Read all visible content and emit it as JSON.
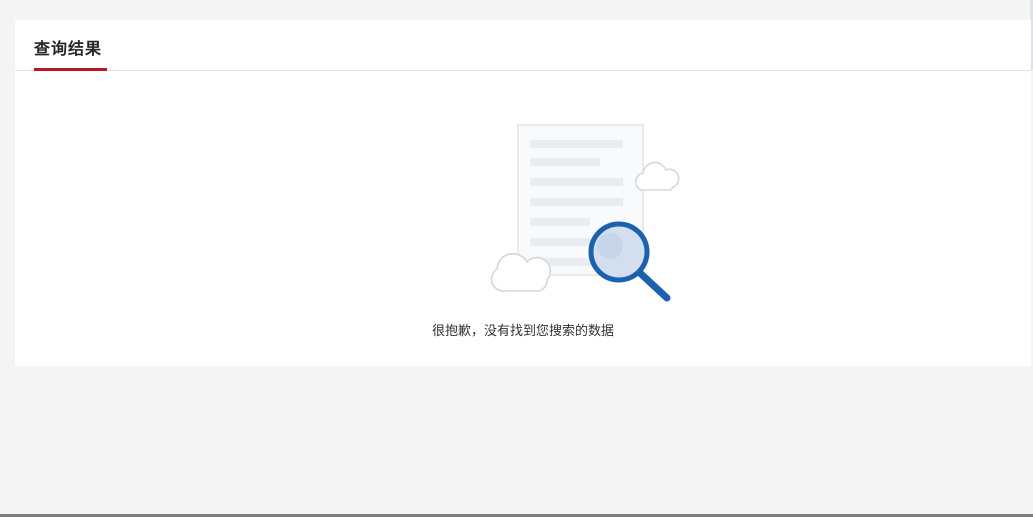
{
  "results": {
    "title": "查询结果",
    "empty_message": "很抱歉，没有找到您搜索的数据"
  },
  "colors": {
    "accent": "#b5182b",
    "page_background": "#f4f4f4",
    "panel_background": "#ffffff",
    "search_icon": "#1a62b0"
  },
  "icons": {
    "illustration": "empty-search-document-icon"
  }
}
